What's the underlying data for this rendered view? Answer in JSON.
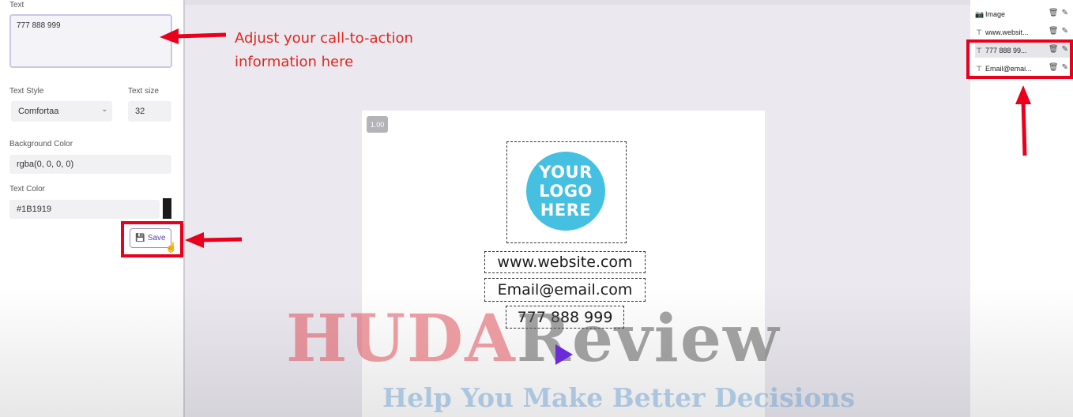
{
  "left_panel": {
    "text_label": "Text",
    "text_value": "777 888 999",
    "text_style_label": "Text Style",
    "text_style_value": "Comfortaa",
    "text_size_label": "Text size",
    "text_size_value": "32",
    "bg_color_label": "Background Color",
    "bg_color_value": "rgba(0, 0, 0, 0)",
    "text_color_label": "Text Color",
    "text_color_value": "#1B1919",
    "text_color_swatch": "#1B1919",
    "save_label": "Save"
  },
  "canvas": {
    "zoom": "1.00",
    "logo_lines": [
      "YOUR",
      "LOGO",
      "HERE"
    ],
    "website": "www.website.com",
    "email": "Email@email.com",
    "phone": "777 888 999"
  },
  "layers": [
    {
      "icon": "camera-icon",
      "label": "Image"
    },
    {
      "icon": "text-icon",
      "label": "www.websit..."
    },
    {
      "icon": "text-icon",
      "label": "777 888 99..."
    },
    {
      "icon": "text-icon",
      "label": "Email@emai..."
    }
  ],
  "annotation": {
    "line1": "Adjust your call-to-action",
    "line2": "information here",
    "color": "#e0261f"
  },
  "watermark": {
    "part1": "HUDA",
    "part2": "Review",
    "tagline": "Help You Make Better Decisions"
  }
}
